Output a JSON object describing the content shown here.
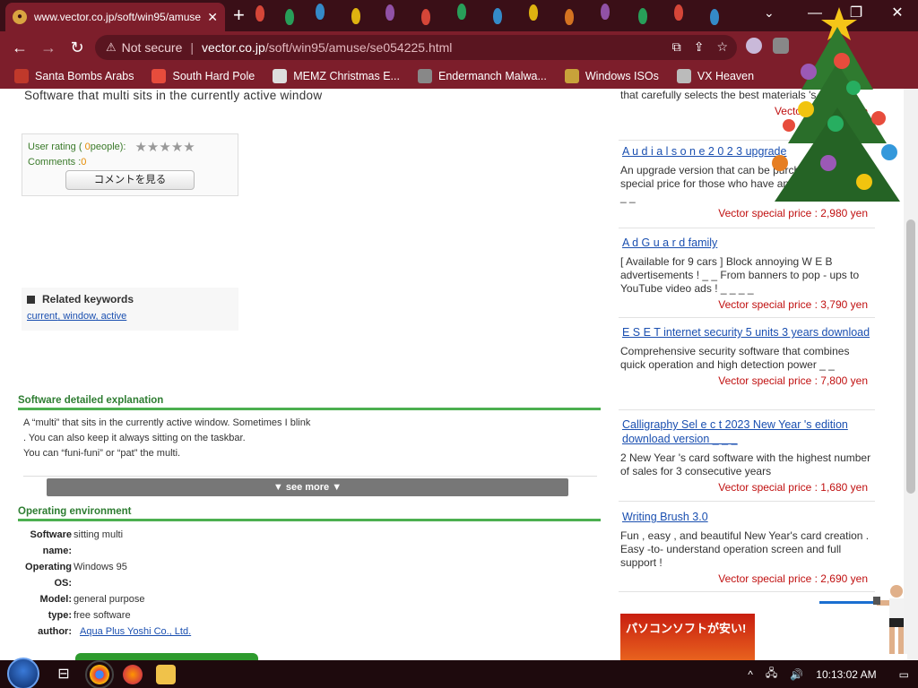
{
  "browser": {
    "tab_title": "www.vector.co.jp/soft/win95/amuse",
    "tab_close": "✕",
    "new_tab": "+",
    "url_security": "Not secure",
    "url_host": "vector.co.jp",
    "url_path": "/soft/win95/amuse/se054225.html",
    "window_controls": [
      "⌄",
      "—",
      "❐",
      "✕"
    ],
    "bookmarks": [
      {
        "label": "Santa Bombs Arabs",
        "color": "#c0392b"
      },
      {
        "label": "South Hard Pole",
        "color": "#e74c3c"
      },
      {
        "label": "MEMZ Christmas E...",
        "color": "#dddddd"
      },
      {
        "label": "Endermanch Malwa...",
        "color": "#888888"
      },
      {
        "label": "Windows ISOs",
        "color": "#c8a23a"
      },
      {
        "label": "VX Heaven",
        "color": "#bbbbbb"
      }
    ]
  },
  "page": {
    "headline": "Software that multi sits in the currently active window",
    "rating": {
      "label_prefix": "User rating (",
      "count": "0",
      "label_suffix": " people):",
      "stars": "★★★★★",
      "comments_label": "Comments : ",
      "comments_count": "0",
      "comment_button": "コメントを見る"
    },
    "keywords": {
      "title": "Related keywords",
      "items": [
        "current",
        ", window",
        ", active"
      ]
    },
    "explanation": {
      "title": "Software detailed explanation",
      "lines": [
        "A “multi” that sits in the currently active window. Sometimes I blink",
        ". You can also keep it always sitting on the taskbar.",
        "You can “funi-funi” or “pat” the multi."
      ],
      "see_more": "▼ see more ▼"
    },
    "environment": {
      "title": "Operating environment",
      "rows": [
        {
          "key": "Software name:",
          "value": "sitting multi"
        },
        {
          "key": "Operating OS:",
          "value": "Windows 95"
        },
        {
          "key": "Model:",
          "value": "general purpose"
        },
        {
          "key": "type:",
          "value": "free software"
        },
        {
          "key": "author:",
          "value": "Aqua Plus Yoshi Co., Ltd."
        }
      ]
    }
  },
  "sidebar": {
    "ads": [
      {
        "title": "",
        "desc": "that carefully selects the best materials 's cards !",
        "price": "Vector special price"
      },
      {
        "title": "A u d i a l s o n e 2 0 2 3 upgrade",
        "desc": "An upgrade version that can be purchased at a special price for those who have an old version _ _ _ _ _",
        "price": "Vector special price : 2,980 yen"
      },
      {
        "title": "A d G u a r d family",
        "desc": "[ Available for 9 cars ] Block annoying W E B advertisements ! _ _ From banners to pop - ups to YouTube video ads ! _ _ _ _",
        "price": "Vector special price : 3,790 yen"
      },
      {
        "title": "E S E T internet security 5 units 3 years download",
        "desc": "Comprehensive security software that combines quick operation and high detection power _ _",
        "price": "Vector special price : 7,800 yen"
      },
      {
        "title": "Calligraphy Sel e c t 2023 New Year 's edition download version _ _ _",
        "desc": "2 New Year 's card software with the highest number of sales for 3 consecutive years",
        "price": "Vector special price : 1,680 yen"
      },
      {
        "title": "Writing Brush 3.0",
        "desc": "Fun , easy , and beautiful New Year's card creation . Easy -to- understand operation screen and full support !",
        "price": "Vector special price : 2,690 yen"
      }
    ],
    "banner_text": "パソコンソフトが安い!"
  },
  "taskbar": {
    "clock": "10:13:02 AM",
    "tray_icons": [
      "^",
      "🖧",
      "🔊"
    ]
  },
  "colors": {
    "tabbar": "#3a0f17",
    "toolbar": "#7d1e2b",
    "section_green": "#2e7d32",
    "link_blue": "#1a4fb0",
    "price_red": "#c01010"
  }
}
